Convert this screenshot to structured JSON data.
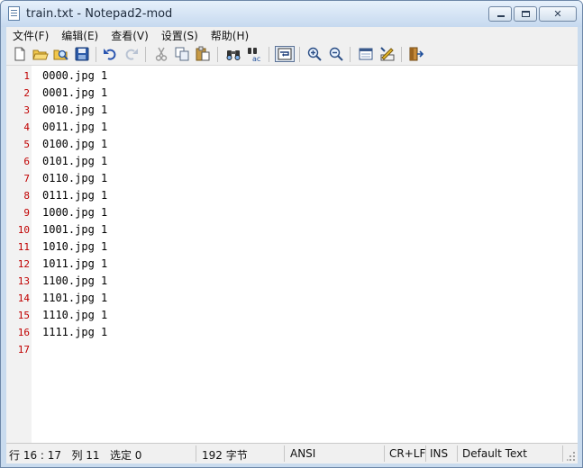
{
  "window": {
    "title": "train.txt - Notepad2-mod"
  },
  "menu": [
    "文件(F)",
    "编辑(E)",
    "查看(V)",
    "设置(S)",
    "帮助(H)"
  ],
  "toolbar": {
    "buttons": [
      "new-icon",
      "open-icon",
      "browse-icon",
      "save-icon",
      "undo-icon",
      "redo-icon",
      "cut-icon",
      "copy-icon",
      "paste-icon",
      "find-icon",
      "replace-icon",
      "word-wrap-icon",
      "zoom-in-icon",
      "zoom-out-icon",
      "scheme-icon",
      "customize-icon",
      "exit-icon"
    ]
  },
  "editor": {
    "line_numbers": [
      "1",
      "2",
      "3",
      "4",
      "5",
      "6",
      "7",
      "8",
      "9",
      "10",
      "11",
      "12",
      "13",
      "14",
      "15",
      "16",
      "17"
    ],
    "lines": [
      "0000.jpg 1",
      "0001.jpg 1",
      "0010.jpg 1",
      "0011.jpg 1",
      "0100.jpg 1",
      "0101.jpg 1",
      "0110.jpg 1",
      "0111.jpg 1",
      "1000.jpg 1",
      "1001.jpg 1",
      "1010.jpg 1",
      "1011.jpg 1",
      "1100.jpg 1",
      "1101.jpg 1",
      "1110.jpg 1",
      "1111.jpg 1",
      ""
    ]
  },
  "status": {
    "position": "行 16 : 17   列 11   选定 0",
    "size": "192 字节",
    "encoding": "ANSI",
    "line_ending": "CR+LF",
    "mode": "INS",
    "scheme": "Default Text"
  },
  "colors": {
    "line_number": "#c00000",
    "gutter": "#f2f2f2",
    "frame": "#c9dbee"
  }
}
